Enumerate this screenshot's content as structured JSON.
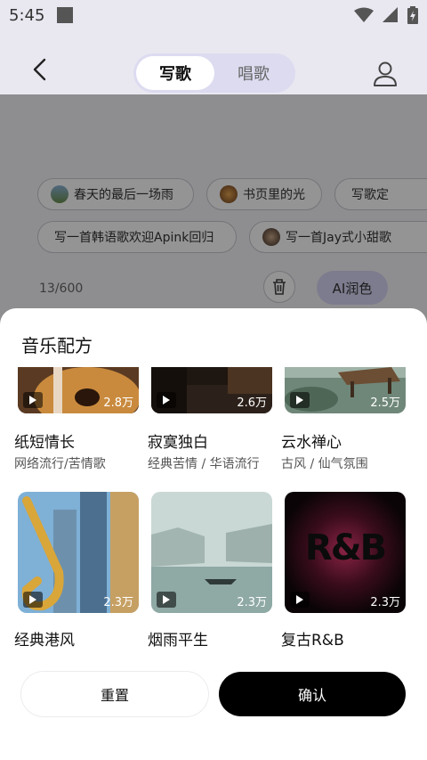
{
  "status_bar": {
    "time": "5:45"
  },
  "header": {
    "tabs": [
      {
        "label": "写歌",
        "active": true
      },
      {
        "label": "唱歌",
        "active": false
      }
    ]
  },
  "background_page": {
    "chips": [
      {
        "label": "春天的最后一场雨",
        "icon": "landscape-thumbnail"
      },
      {
        "label": "书页里的光",
        "icon": "book-thumbnail"
      },
      {
        "label": "写歌定",
        "icon": ""
      },
      {
        "label": "写一首韩语歌欢迎Apink回归",
        "icon": ""
      },
      {
        "label": "写一首Jay式小甜歌",
        "icon": "portrait-thumbnail"
      }
    ],
    "char_count": "13/600",
    "ai_polish_label": "AI润色"
  },
  "sheet": {
    "title": "音乐配方",
    "recipes": [
      {
        "play_count": "2.8万",
        "title": "纸短情长",
        "subtitle": "网络流行/苦情歌",
        "image": "guitar-image"
      },
      {
        "play_count": "2.6万",
        "title": "寂寞独白",
        "subtitle": "经典苦情 / 华语流行",
        "image": "dark-room-image"
      },
      {
        "play_count": "2.5万",
        "title": "云水禅心",
        "subtitle": "古风 / 仙气氛围",
        "image": "zen-pavilion-image"
      },
      {
        "play_count": "2.3万",
        "title": "经典港风",
        "subtitle": "",
        "image": "saxophone-city-image"
      },
      {
        "play_count": "2.3万",
        "title": "烟雨平生",
        "subtitle": "",
        "image": "misty-water-town-image"
      },
      {
        "play_count": "2.3万",
        "title": "复古R&B",
        "subtitle": "",
        "image": "rnb-logo-image",
        "logo_text": "R&B"
      }
    ],
    "reset_label": "重置",
    "confirm_label": "确认"
  },
  "colors": {
    "accent": "#d7d6f5",
    "confirm": "#000000",
    "header_bg": "#e9e8f1"
  }
}
